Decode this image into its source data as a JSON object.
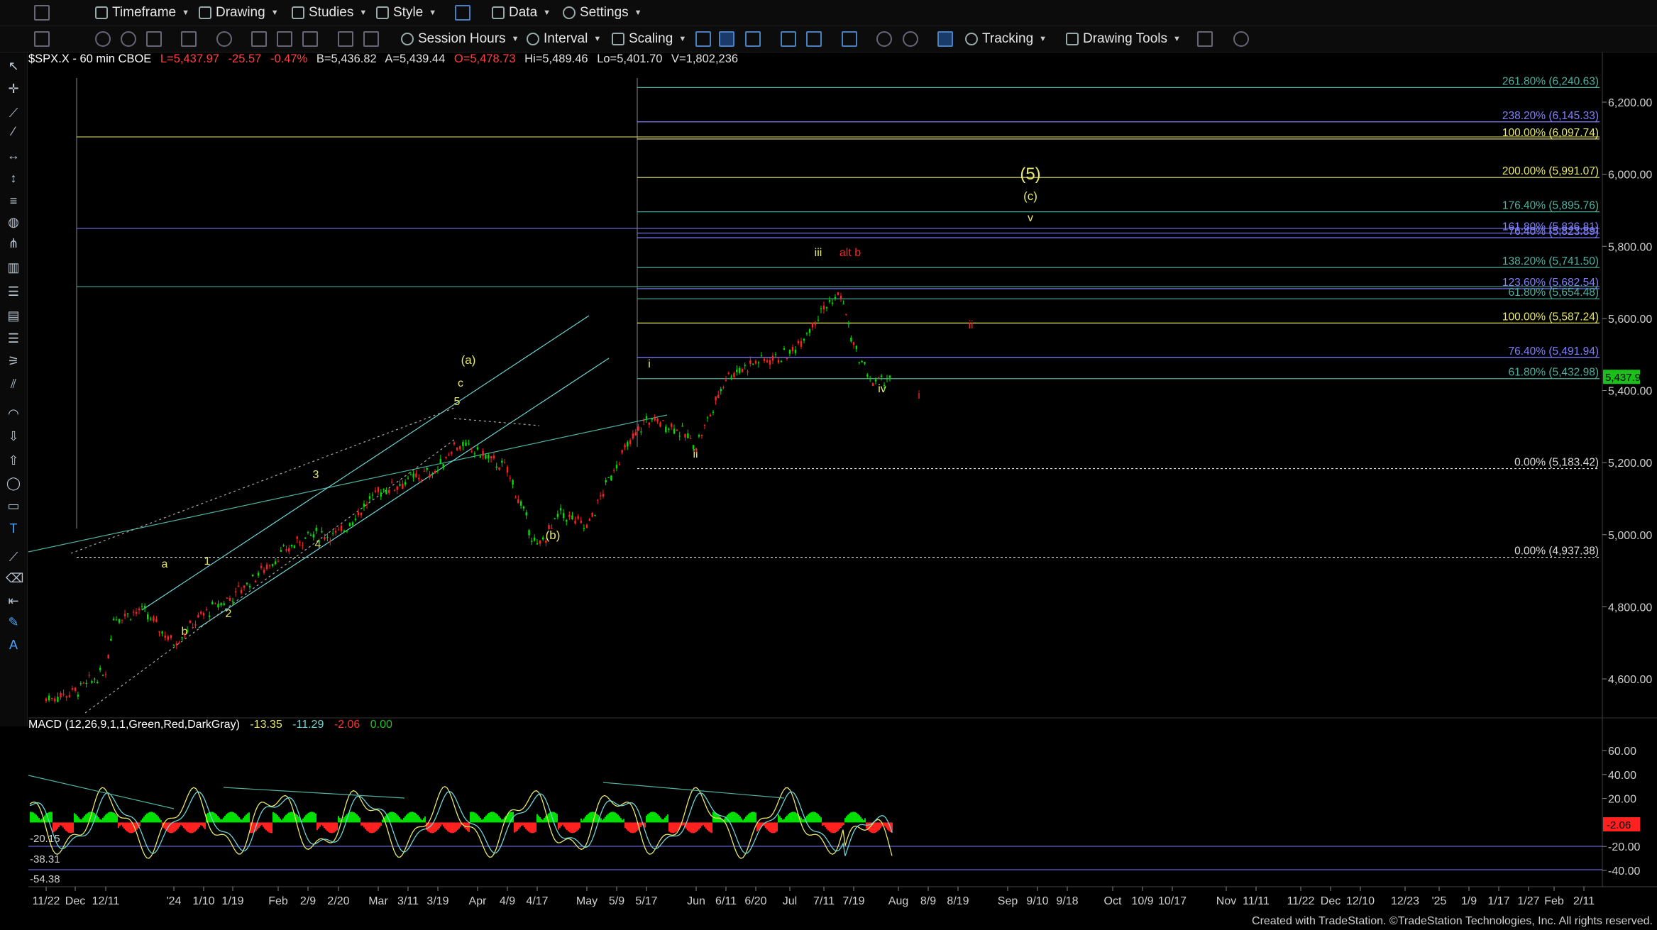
{
  "toolbar1": {
    "timeframe": "Timeframe",
    "drawing": "Drawing",
    "studies": "Studies",
    "style": "Style",
    "data": "Data",
    "settings": "Settings"
  },
  "toolbar2": {
    "session": "Session Hours",
    "interval": "Interval",
    "scaling": "Scaling",
    "tracking": "Tracking",
    "drawing_tools": "Drawing Tools"
  },
  "symbol_info": {
    "symbol": "$SPX.X - 60 min CBOE",
    "last": "L=5,437.97",
    "change": "-25.57",
    "change_pct": "-0.47%",
    "bid": "B=5,436.82",
    "ask": "A=5,439.44",
    "open": "O=5,478.73",
    "high": "Hi=5,489.46",
    "low": "Lo=5,401.70",
    "volume": "V=1,802,236"
  },
  "macd_info": {
    "label": "MACD (12,26,9,1,1,Green,Red,DarkGray)",
    "v1": "-13.35",
    "v2": "-11.29",
    "v3": "-2.06",
    "v4": "0.00"
  },
  "footer": "Created with TradeStation. ©TradeStation Technologies, Inc. All rights reserved.",
  "colors": {
    "green": "#00ff00",
    "red": "#ff2020",
    "yellow": "#e8e86c",
    "cyan": "#6fd3d3",
    "blue": "#7a7aff",
    "teal": "#4fb0a0"
  },
  "chart_data": [
    {
      "type": "candlestick",
      "title": "$SPX.X - 60 min",
      "ylim": [
        4400,
        6300
      ],
      "y_ticks": [
        "6,200.00",
        "6,000.00",
        "5,800.00",
        "5,600.00",
        "5,400.00",
        "5,200.00",
        "5,000.00",
        "4,800.00",
        "4,600.00"
      ],
      "y_tick_values": [
        6200,
        6000,
        5800,
        5600,
        5400,
        5200,
        5000,
        4800,
        4600
      ],
      "last_price_label": "5,437.97",
      "x_tick_labels": [
        "11/22",
        "Dec",
        "12/11",
        "'24",
        "1/10",
        "1/19",
        "Feb",
        "2/9",
        "2/20",
        "Mar",
        "3/11",
        "3/19",
        "Apr",
        "4/9",
        "4/17",
        "May",
        "5/9",
        "5/17",
        "Jun",
        "6/11",
        "6/20",
        "Jul",
        "7/11",
        "7/19",
        "Aug",
        "8/9",
        "8/19",
        "Sep",
        "9/10",
        "9/18",
        "Oct",
        "10/9",
        "10/17",
        "Nov",
        "11/11",
        "11/22",
        "Dec",
        "12/10",
        "12/23",
        "'25",
        "1/9",
        "1/17",
        "1/27",
        "Feb",
        "2/11"
      ],
      "price_path": [
        {
          "x": "11/22",
          "y": 4545
        },
        {
          "x": "Dec",
          "y": 4565
        },
        {
          "x": "12/11",
          "y": 4620
        },
        {
          "x": "12/20",
          "y": 4770
        },
        {
          "x": "12/28",
          "y": 4790
        },
        {
          "x": "'24",
          "y": 4700
        },
        {
          "x": "1/10",
          "y": 4780
        },
        {
          "x": "1/19",
          "y": 4830
        },
        {
          "x": "Feb",
          "y": 4940
        },
        {
          "x": "2/9",
          "y": 5000
        },
        {
          "x": "2/20",
          "y": 5000
        },
        {
          "x": "Mar",
          "y": 5120
        },
        {
          "x": "3/11",
          "y": 5150
        },
        {
          "x": "3/19",
          "y": 5180
        },
        {
          "x": "3/28",
          "y": 5250
        },
        {
          "x": "Apr",
          "y": 5230
        },
        {
          "x": "4/9",
          "y": 5180
        },
        {
          "x": "4/17",
          "y": 4960
        },
        {
          "x": "4/25",
          "y": 5060
        },
        {
          "x": "May",
          "y": 5020
        },
        {
          "x": "5/9",
          "y": 5200
        },
        {
          "x": "5/17",
          "y": 5320
        },
        {
          "x": "5/24",
          "y": 5300
        },
        {
          "x": "Jun",
          "y": 5250
        },
        {
          "x": "6/5",
          "y": 5350
        },
        {
          "x": "6/11",
          "y": 5440
        },
        {
          "x": "6/20",
          "y": 5480
        },
        {
          "x": "Jul",
          "y": 5500
        },
        {
          "x": "7/11",
          "y": 5630
        },
        {
          "x": "7/16",
          "y": 5667
        },
        {
          "x": "7/19",
          "y": 5520
        },
        {
          "x": "7/25",
          "y": 5420
        },
        {
          "x": "7/30",
          "y": 5438
        }
      ],
      "fib_levels": [
        {
          "label": "261.80% (6,240.63)",
          "value": 6240.63,
          "color": "#4fb0a0"
        },
        {
          "label": "238.20% (6,145.33)",
          "value": 6145.33,
          "color": "#8080ff"
        },
        {
          "label": "100.00% (6,097.74)",
          "value": 6097.74,
          "color": "#e8e86c"
        },
        {
          "label": "200.00% (5,991.07)",
          "value": 5991.07,
          "color": "#e8e86c"
        },
        {
          "label": "176.40% (5,895.76)",
          "value": 5895.76,
          "color": "#4fb0a0"
        },
        {
          "label": "161.80% (5,836.81)",
          "value": 5836.81,
          "color": "#8080ff"
        },
        {
          "label": "76.40% (5,823.89)",
          "value": 5823.89,
          "color": "#8080ff"
        },
        {
          "label": "138.20% (5,741.50)",
          "value": 5741.5,
          "color": "#4fb0a0"
        },
        {
          "label": "123.60% (5,682.54)",
          "value": 5682.54,
          "color": "#8080ff"
        },
        {
          "label": "61.80% (5,654.48)",
          "value": 5654.48,
          "color": "#4fb0a0"
        },
        {
          "label": "100.00% (5,587.24)",
          "value": 5587.24,
          "color": "#e8e86c"
        },
        {
          "label": "76.40% (5,491.94)",
          "value": 5491.94,
          "color": "#8080ff"
        },
        {
          "label": "61.80% (5,432.98)",
          "value": 5432.98,
          "color": "#4fb0a0"
        },
        {
          "label": "0.00% (5,183.42)",
          "value": 5183.42,
          "color": "#dddddd"
        },
        {
          "label": "0.00% (4,937.38)",
          "value": 4937.38,
          "color": "#dddddd"
        }
      ],
      "wave_labels": [
        {
          "text": "a",
          "color": "#e8e86c"
        },
        {
          "text": "b",
          "color": "#e8e86c"
        },
        {
          "text": "1",
          "color": "#e8e86c"
        },
        {
          "text": "2",
          "color": "#e8e86c"
        },
        {
          "text": "3",
          "color": "#e8e86c"
        },
        {
          "text": "4",
          "color": "#e8e86c"
        },
        {
          "text": "5",
          "color": "#e8e86c"
        },
        {
          "text": "c",
          "color": "#e8e86c"
        },
        {
          "text": "(a)",
          "color": "#e8e86c"
        },
        {
          "text": "(b)",
          "color": "#e8e86c"
        },
        {
          "text": "i",
          "color": "#e8e86c"
        },
        {
          "text": "ii",
          "color": "#e8e86c"
        },
        {
          "text": "iii",
          "color": "#e8e86c"
        },
        {
          "text": "alt b",
          "color": "#ff2020"
        },
        {
          "text": "iv",
          "color": "#e8e86c"
        },
        {
          "text": "ii",
          "color": "#ff2020"
        },
        {
          "text": "i",
          "color": "#ff2020"
        },
        {
          "text": "(5)",
          "color": "#e8e86c"
        },
        {
          "text": "(c)",
          "color": "#e8e86c"
        },
        {
          "text": "v",
          "color": "#e8e86c"
        }
      ]
    },
    {
      "type": "bar",
      "title": "MACD (12,26,9,1,1,Green,Red,DarkGray)",
      "ylim": [
        -45,
        70
      ],
      "y_ticks": [
        "60.00",
        "40.00",
        "20.00",
        "-20.00",
        "-40.00"
      ],
      "y_tick_values": [
        60,
        40,
        20,
        -20,
        -40
      ],
      "current_label": "-2.06",
      "ref_lines": [
        "-20.15",
        "-38.31",
        "-54.38"
      ],
      "histogram_sign_pattern": [
        1,
        -1,
        1,
        1,
        -1,
        1,
        -1,
        -1,
        1,
        1,
        -1,
        1,
        1,
        -1,
        1,
        -1,
        1,
        1,
        -1,
        -1,
        1,
        1,
        -1,
        1,
        -1,
        1,
        1,
        -1,
        1,
        -1,
        -1,
        1,
        1,
        -1,
        1,
        1,
        -1,
        1,
        -1,
        -1
      ]
    }
  ]
}
